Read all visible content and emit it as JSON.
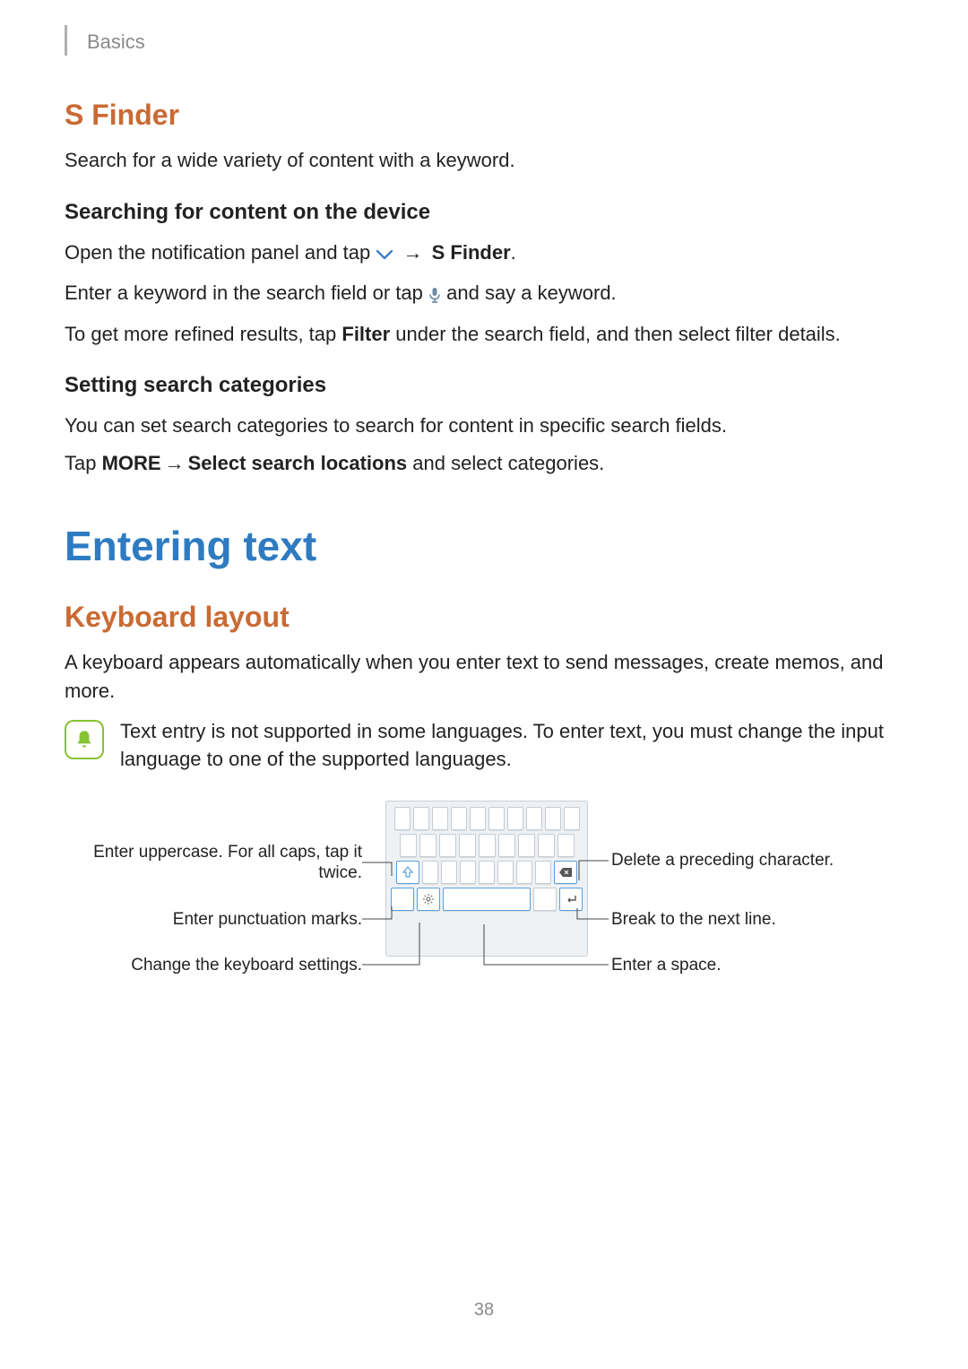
{
  "header": {
    "section": "Basics"
  },
  "sfinder": {
    "title": "S Finder",
    "intro": "Search for a wide variety of content with a keyword.",
    "search_heading": "Searching for content on the device",
    "open_panel_pre": "Open the notification panel and tap ",
    "open_panel_arrow": " → ",
    "open_panel_bold": "S Finder",
    "open_panel_post": ".",
    "enter_keyword_pre": "Enter a keyword in the search field or tap ",
    "enter_keyword_post": " and say a keyword.",
    "refined_pre": "To get more refined results, tap ",
    "refined_bold": "Filter",
    "refined_post": " under the search field, and then select filter details.",
    "cat_heading": "Setting search categories",
    "cat_body": "You can set search categories to search for content in specific search fields.",
    "cat_tap_pre": "Tap ",
    "cat_tap_more": "MORE",
    "cat_tap_arrow": " → ",
    "cat_tap_bold": "Select search locations",
    "cat_tap_post": " and select categories."
  },
  "entering": {
    "title": "Entering text",
    "kbd_heading": "Keyboard layout",
    "kbd_body": "A keyboard appears automatically when you enter text to send messages, create memos, and more.",
    "note": "Text entry is not supported in some languages. To enter text, you must change the input language to one of the supported languages."
  },
  "callouts": {
    "uppercase": "Enter uppercase. For all caps, tap it twice.",
    "punct": "Enter punctuation marks.",
    "settings": "Change the keyboard settings.",
    "delete": "Delete a preceding character.",
    "break": "Break to the next line.",
    "space": "Enter a space."
  },
  "page_number": "38",
  "colors": {
    "accent_orange": "#c96a34",
    "accent_blue": "#2f7bc2",
    "note_green": "#86c232",
    "hl_blue": "#5aa0e0"
  }
}
